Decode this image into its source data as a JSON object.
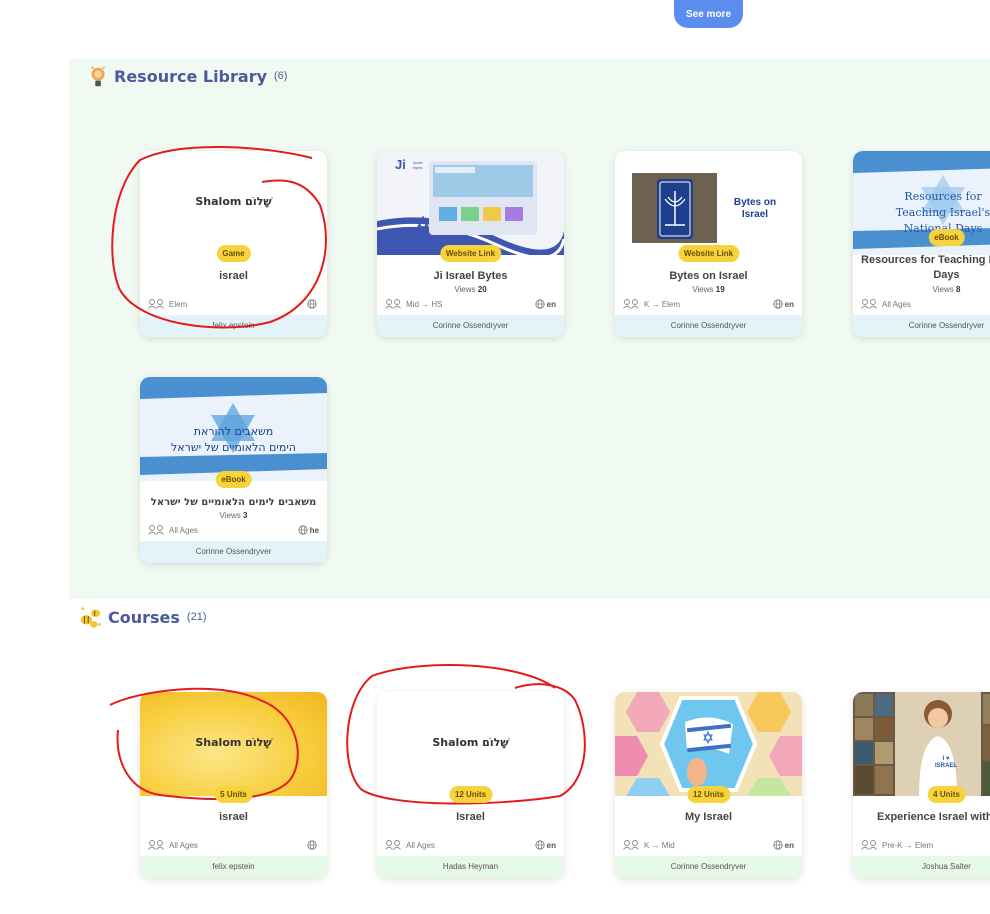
{
  "top": {
    "see_more": "See more"
  },
  "resources": {
    "title": "Resource Library",
    "count": "(6)",
    "cards": [
      {
        "shalom": "Shalom שָׁלוֹם",
        "badge": "Game",
        "title": "israel",
        "grade": "Elem",
        "lang": "",
        "author": "felix epstein"
      },
      {
        "badge": "Website Link",
        "title": "Ji Israel Bytes",
        "views_label": "Views",
        "views": "20",
        "grade": "Mid → HS",
        "lang": "en",
        "author": "Corinne Ossendryver",
        "thumb_logo": "Ji",
        "thumb_logo_sub": "Israel bytes"
      },
      {
        "badge": "Website Link",
        "title": "Bytes on Israel",
        "views_label": "Views",
        "views": "19",
        "grade": "K → Elem",
        "lang": "en",
        "author": "Corinne Ossendryver",
        "thumb_text": "Bytes on Israel"
      },
      {
        "badge": "eBook",
        "title": "Resources for Teaching National Days",
        "views_label": "Views",
        "views": "8",
        "grade": "All Ages",
        "lang": "",
        "author": "Corinne Ossendryver",
        "thumb_text": "Resources for Teaching Israel's National Days"
      },
      {
        "badge": "eBook",
        "title": "משאבים לימים הלאומיים של ישראל",
        "views_label": "Views",
        "views": "3",
        "grade": "All Ages",
        "lang": "he",
        "author": "Corinne Ossendryver",
        "thumb_text_1": "משאבים להוראת",
        "thumb_text_2": "הימים הלאומיים של ישראל"
      }
    ]
  },
  "courses": {
    "title": "Courses",
    "count": "(21)",
    "cards": [
      {
        "shalom": "Shalom שָׁלוֹם",
        "badge": "5 Units",
        "title": "israel",
        "grade": "All Ages",
        "lang": "",
        "author": "felix epstein"
      },
      {
        "shalom": "Shalom שָׁלוֹם",
        "badge": "12 Units",
        "title": "Israel",
        "grade": "All Ages",
        "lang": "en",
        "author": "Hadas Heyman"
      },
      {
        "badge": "12 Units",
        "title": "My Israel",
        "grade": "K → Mid",
        "lang": "en",
        "author": "Corinne Ossendryver"
      },
      {
        "badge": "4 Units",
        "title": "Experience Israel with",
        "grade": "Pre-K → Elem",
        "lang": "",
        "author": "Joshua Salter",
        "thumb_text": "I ♥ ISRAEL"
      }
    ]
  },
  "colors": {
    "accent": "#5b8def",
    "title": "#4b5a9c",
    "badge": "#f6d23c",
    "section_bg": "#f1faf2",
    "scribble": "#e31b1b"
  }
}
